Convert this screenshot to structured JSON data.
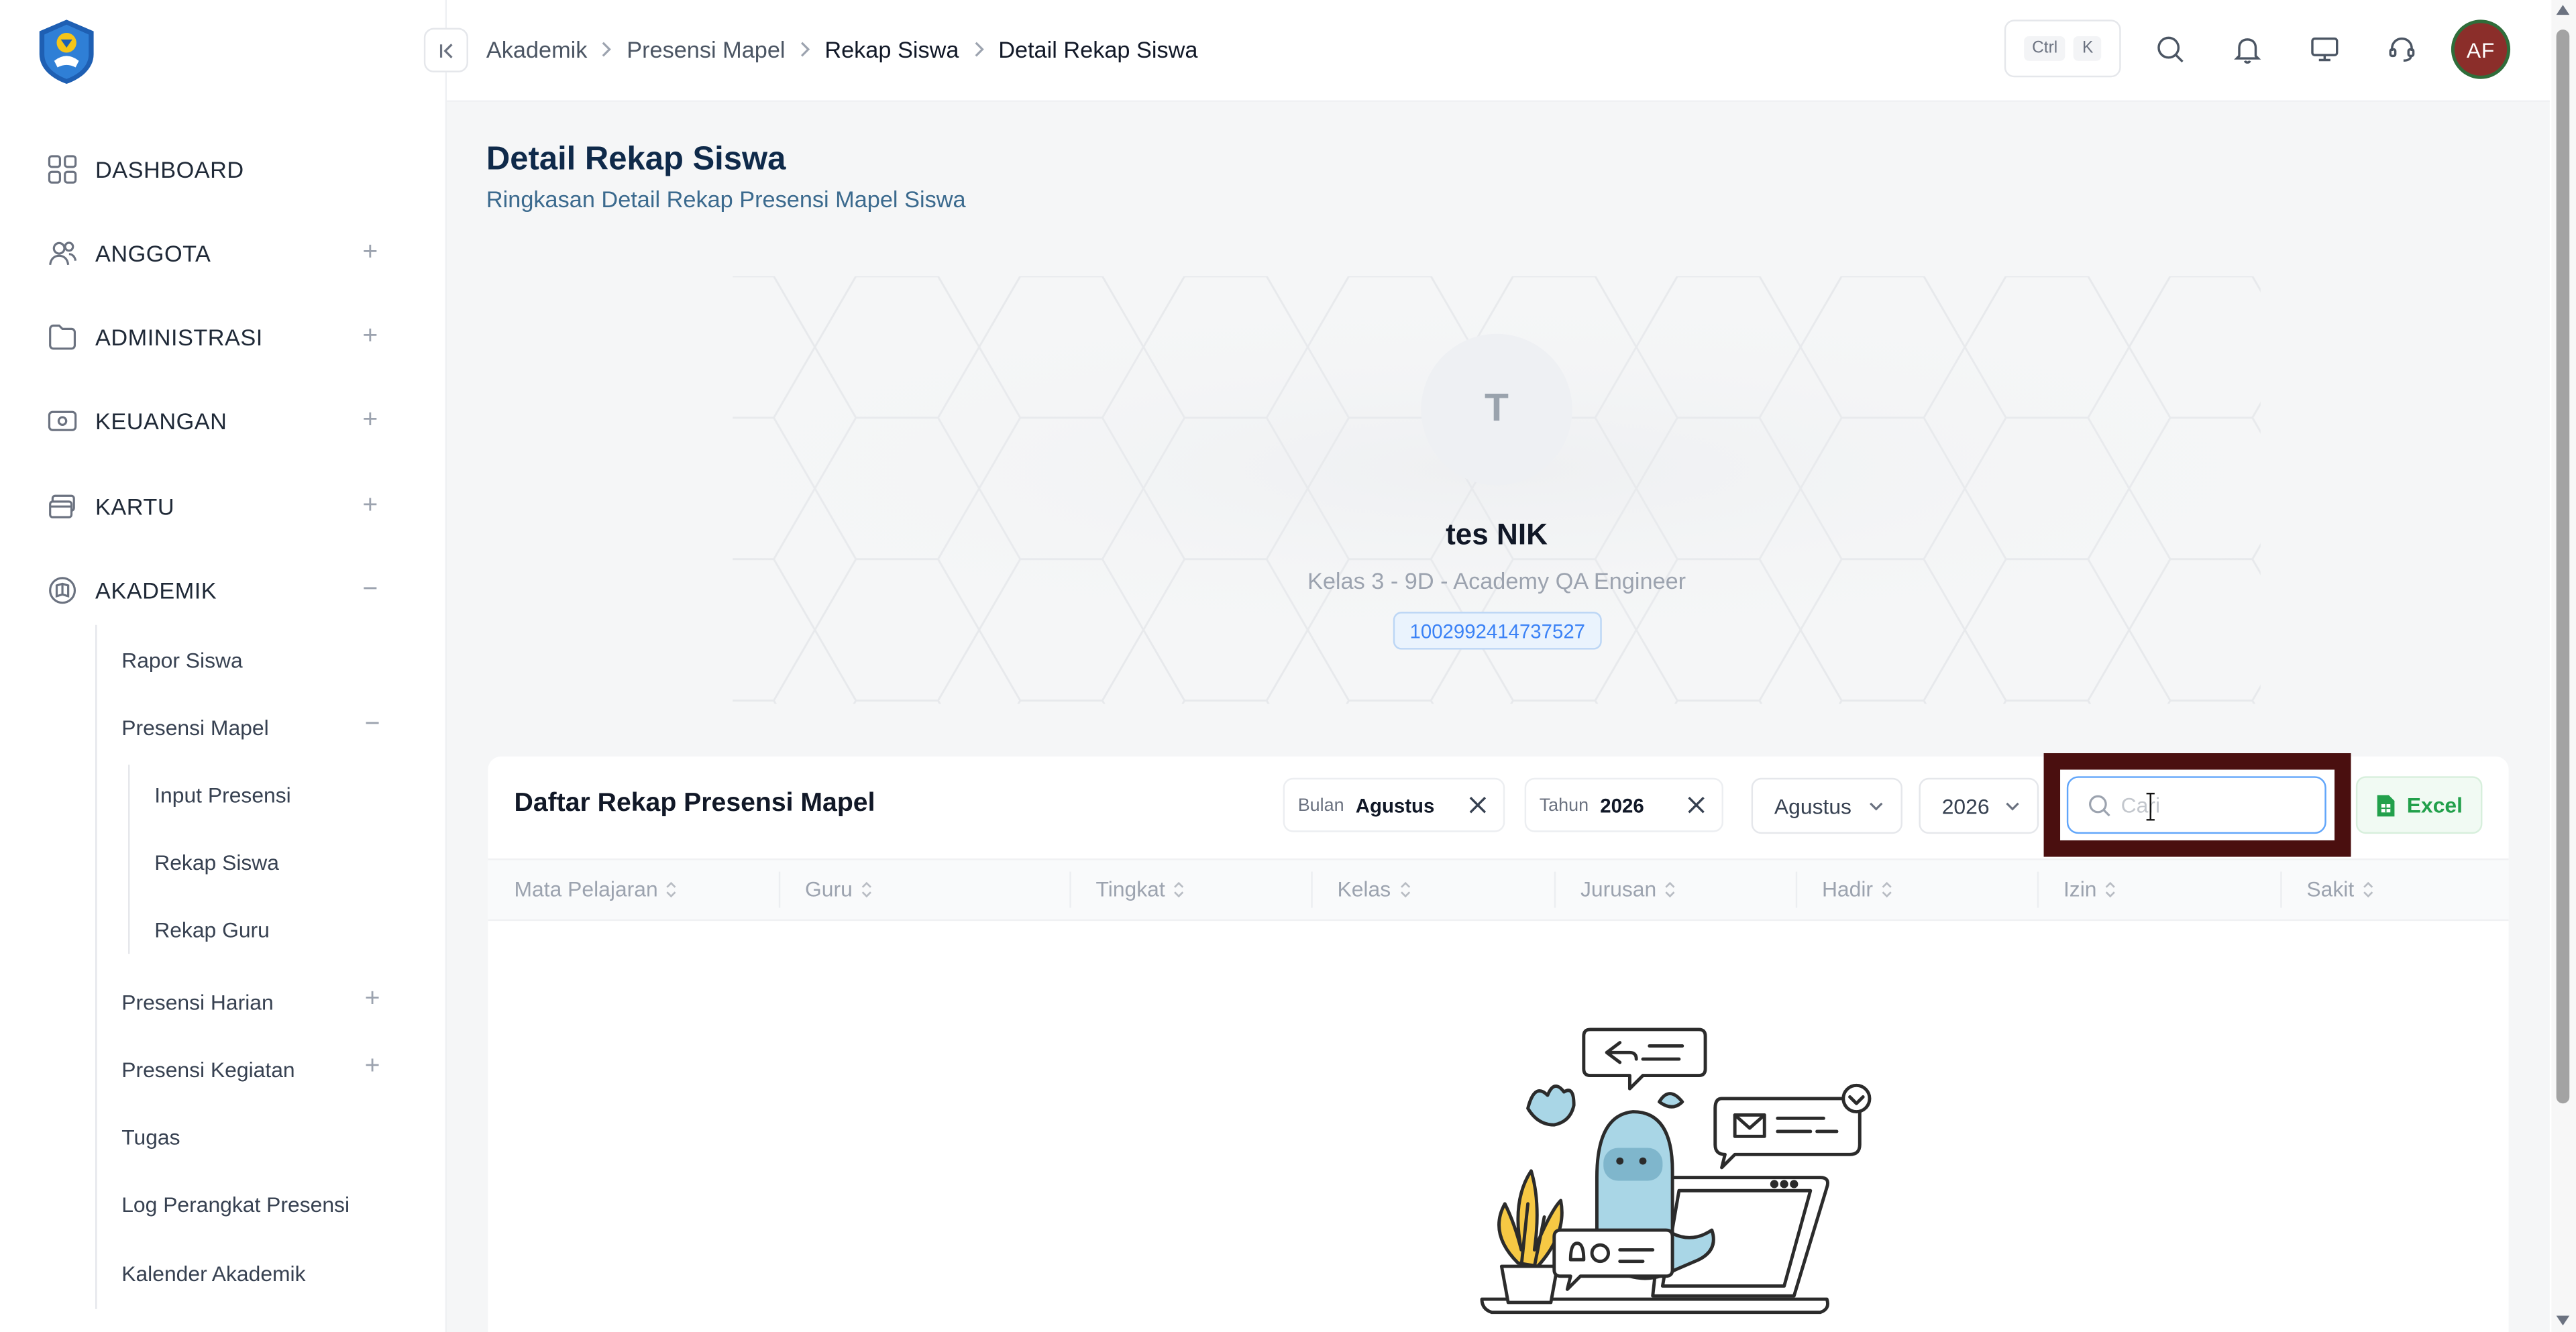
{
  "sidebar": {
    "menu": [
      {
        "label": "DASHBOARD",
        "icon": "grid-icon",
        "toggle": ""
      },
      {
        "label": "ANGGOTA",
        "icon": "users-icon",
        "toggle": "+"
      },
      {
        "label": "ADMINISTRASI",
        "icon": "folder-icon",
        "toggle": "+"
      },
      {
        "label": "KEUANGAN",
        "icon": "banknote-icon",
        "toggle": "+"
      },
      {
        "label": "KARTU",
        "icon": "card-icon",
        "toggle": "+"
      },
      {
        "label": "AKADEMIK",
        "icon": "book-icon",
        "toggle": "−"
      }
    ],
    "akademik_sub": [
      {
        "label": "Rapor Siswa",
        "toggle": ""
      },
      {
        "label": "Presensi Mapel",
        "toggle": "−"
      },
      {
        "label": "Presensi Harian",
        "toggle": "+"
      },
      {
        "label": "Presensi Kegiatan",
        "toggle": "+"
      },
      {
        "label": "Tugas",
        "toggle": ""
      },
      {
        "label": "Log Perangkat Presensi",
        "toggle": ""
      },
      {
        "label": "Kalender Akademik",
        "toggle": ""
      }
    ],
    "presensi_mapel_sub": [
      {
        "label": "Input Presensi"
      },
      {
        "label": "Rekap Siswa"
      },
      {
        "label": "Rekap Guru"
      }
    ]
  },
  "header": {
    "breadcrumb": [
      "Akademik",
      "Presensi Mapel",
      "Rekap Siswa",
      "Detail Rekap Siswa"
    ],
    "shortcut_keys": [
      "Ctrl",
      "K"
    ],
    "avatar_initials": "AF"
  },
  "page": {
    "title": "Detail Rekap Siswa",
    "subtitle": "Ringkasan Detail Rekap Presensi Mapel Siswa"
  },
  "profile": {
    "initial": "T",
    "name": "tes NIK",
    "class_info": "Kelas 3 - 9D - Academy QA Engineer",
    "nis": "1002992414737527"
  },
  "table_card": {
    "title": "Daftar Rekap Presensi Mapel",
    "filters": [
      {
        "key": "Bulan",
        "value": "Agustus"
      },
      {
        "key": "Tahun",
        "value": "2026"
      }
    ],
    "month_select": "Agustus",
    "year_select": "2026",
    "search_placeholder": "Cari",
    "search_value": "",
    "excel_label": "Excel",
    "columns": [
      "Mata Pelajaran",
      "Guru",
      "Tingkat",
      "Kelas",
      "Jurusan",
      "Hadir",
      "Izin",
      "Sakit"
    ]
  },
  "colors": {
    "primary_text": "#0f2a4a",
    "accent_blue": "#3b82f6",
    "excel_green": "#22a04b",
    "highlight_box": "#4a0f0f",
    "avatar_bg": "#8b2e2a"
  }
}
